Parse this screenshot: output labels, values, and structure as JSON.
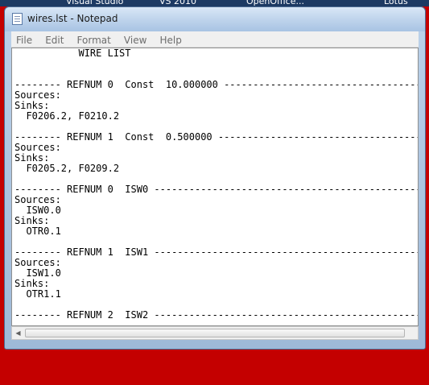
{
  "background_apps": [
    "Visual Studio",
    "VS 2010",
    "OpenOffice...",
    "Lotus"
  ],
  "window": {
    "title": "wires.lst - Notepad",
    "menu": [
      "File",
      "Edit",
      "Format",
      "View",
      "Help"
    ]
  },
  "editor": {
    "lines": [
      "           WIRE LIST",
      "",
      "",
      "-------- REFNUM 0  Const  10.000000 ----------------------------------------",
      "Sources:",
      "Sinks:",
      "  F0206.2, F0210.2",
      "",
      "-------- REFNUM 1  Const  0.500000 -----------------------------------------",
      "Sources:",
      "Sinks:",
      "  F0205.2, F0209.2",
      "",
      "-------- REFNUM 0  ISW0 ---------------------------------------------------",
      "Sources:",
      "  ISW0.0",
      "Sinks:",
      "  OTR0.1",
      "",
      "-------- REFNUM 1  ISW1 ---------------------------------------------------",
      "Sources:",
      "  ISW1.0",
      "Sinks:",
      "  OTR1.1",
      "",
      "-------- REFNUM 2  ISW2 ---------------------------------------------------"
    ]
  },
  "colors": {
    "desktop_background": "#c40000",
    "title_bar": "#bfd4ec",
    "menu_text": "#6d6d6d"
  }
}
